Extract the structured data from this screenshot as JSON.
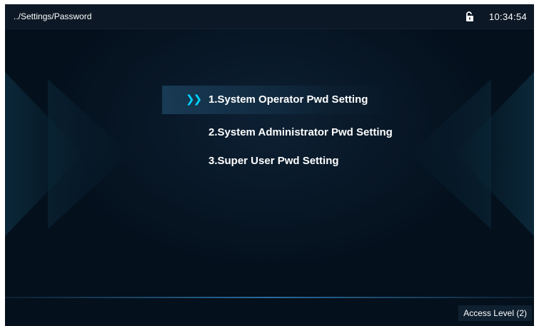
{
  "header": {
    "breadcrumb": "../Settings/Password",
    "lock_icon": "unlocked-padlock-icon",
    "time": "10:34:54"
  },
  "menu": {
    "selected_indicator": "double-chevron-right-icon",
    "items": [
      {
        "label": "1.System Operator Pwd Setting",
        "selected": true
      },
      {
        "label": "2.System Administrator Pwd Setting",
        "selected": false
      },
      {
        "label": "3.Super User Pwd Setting",
        "selected": false
      }
    ]
  },
  "footer": {
    "access_level": "Access Level  (2)"
  },
  "colors": {
    "background": "#04101c",
    "header_bg": "#0c1825",
    "accent": "#00d4ff",
    "text": "#ffffff"
  }
}
